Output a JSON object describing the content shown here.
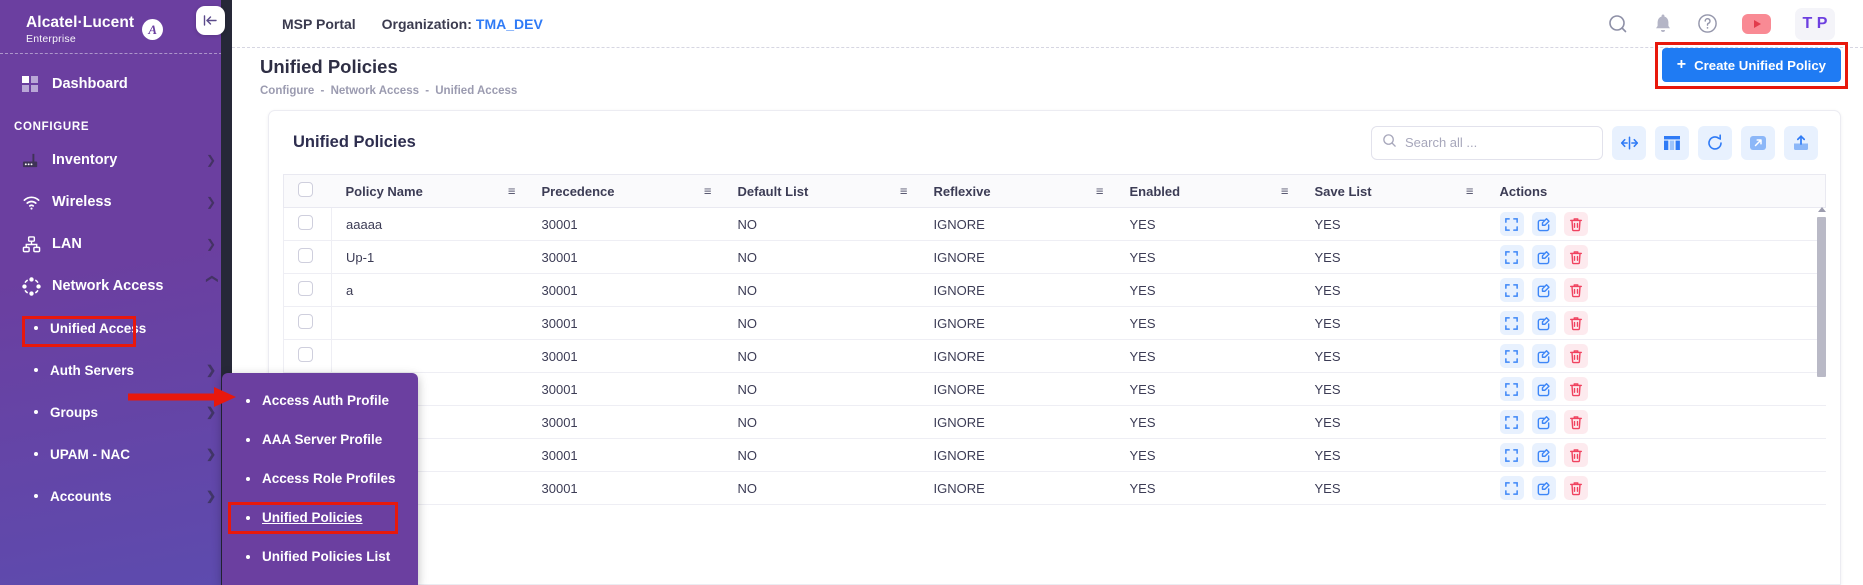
{
  "brand": {
    "name": "Alcatel·Lucent",
    "sub": "Enterprise",
    "logo_icon": "alcatel-lucent-logo-icon"
  },
  "topbar": {
    "collapse_icon": "collapse-sidebar-icon",
    "msp_portal": "MSP Portal",
    "organization_label": "Organization:",
    "organization_value": "TMA_DEV",
    "icons": {
      "search": "search-icon",
      "notifications": "bell-icon",
      "help": "help-circle-icon",
      "video": "youtube-play-icon"
    },
    "avatar_initials": "T P"
  },
  "page": {
    "title": "Unified Policies",
    "breadcrumb": [
      "Configure",
      "Network Access",
      "Unified Access"
    ],
    "breadcrumb_separator": "-",
    "create_button": "Create Unified Policy",
    "create_button_plus": "+",
    "create_button_color": "#1f7bf3",
    "highlight_color": "#e8180c"
  },
  "sidebar": {
    "dashboard": {
      "label": "Dashboard",
      "icon": "dashboard-grid-icon"
    },
    "section_label": "CONFIGURE",
    "items": [
      {
        "label": "Inventory",
        "icon": "router-icon",
        "chevron": "chevron-right-icon"
      },
      {
        "label": "Wireless",
        "icon": "wifi-icon",
        "chevron": "chevron-down-icon"
      },
      {
        "label": "LAN",
        "icon": "lan-topology-icon",
        "chevron": "chevron-down-icon"
      },
      {
        "label": "Network Access",
        "icon": "network-access-icon",
        "chevron": "chevron-up-icon"
      }
    ],
    "sub_items": [
      {
        "label": "Unified Access",
        "chevron": "",
        "highlighted": true
      },
      {
        "label": "Auth Servers",
        "chevron": "chevron-right-icon"
      },
      {
        "label": "Groups",
        "chevron": "chevron-right-icon"
      },
      {
        "label": "UPAM - NAC",
        "chevron": "chevron-right-icon"
      },
      {
        "label": "Accounts",
        "chevron": "chevron-right-icon"
      }
    ]
  },
  "flyout": {
    "items": [
      {
        "label": "Access Auth Profile"
      },
      {
        "label": "AAA Server Profile"
      },
      {
        "label": "Access Role Profiles"
      },
      {
        "label": "Unified Policies",
        "active": true
      },
      {
        "label": "Unified Policies List"
      }
    ],
    "arrow_icon": "red-arrow-pointer-icon"
  },
  "card": {
    "title": "Unified Policies",
    "search": {
      "placeholder": "Search all ...",
      "value": "",
      "icon": "search-icon"
    },
    "tools": [
      {
        "name": "fit-columns-icon",
        "glyph": "↔"
      },
      {
        "name": "column-settings-icon",
        "glyph": "▥"
      },
      {
        "name": "refresh-icon",
        "glyph": "⟳"
      },
      {
        "name": "expand-fullscreen-icon",
        "glyph": "↗"
      },
      {
        "name": "export-upload-icon",
        "glyph": "↑"
      }
    ]
  },
  "table": {
    "columns": [
      {
        "key": "select",
        "label": ""
      },
      {
        "key": "policy_name",
        "label": "Policy Name",
        "menu_icon": "column-menu-icon"
      },
      {
        "key": "precedence",
        "label": "Precedence",
        "menu_icon": "column-menu-icon"
      },
      {
        "key": "default_list",
        "label": "Default List",
        "menu_icon": "column-menu-icon"
      },
      {
        "key": "reflexive",
        "label": "Reflexive",
        "menu_icon": "column-menu-icon"
      },
      {
        "key": "enabled",
        "label": "Enabled",
        "menu_icon": "column-menu-icon"
      },
      {
        "key": "save_list",
        "label": "Save List",
        "menu_icon": "column-menu-icon"
      },
      {
        "key": "actions",
        "label": "Actions"
      }
    ],
    "action_icons": [
      {
        "name": "view-details-icon"
      },
      {
        "name": "edit-pencil-icon"
      },
      {
        "name": "delete-trash-icon"
      }
    ],
    "rows": [
      {
        "policy_name": "aaaaa",
        "precedence": "30001",
        "default_list": "NO",
        "reflexive": "IGNORE",
        "enabled": "YES",
        "save_list": "YES"
      },
      {
        "policy_name": "Up-1",
        "precedence": "30001",
        "default_list": "NO",
        "reflexive": "IGNORE",
        "enabled": "YES",
        "save_list": "YES"
      },
      {
        "policy_name": "a",
        "precedence": "30001",
        "default_list": "NO",
        "reflexive": "IGNORE",
        "enabled": "YES",
        "save_list": "YES"
      },
      {
        "policy_name": "",
        "precedence": "30001",
        "default_list": "NO",
        "reflexive": "IGNORE",
        "enabled": "YES",
        "save_list": "YES"
      },
      {
        "policy_name": "",
        "precedence": "30001",
        "default_list": "NO",
        "reflexive": "IGNORE",
        "enabled": "YES",
        "save_list": "YES"
      },
      {
        "policy_name": "",
        "precedence": "30001",
        "default_list": "NO",
        "reflexive": "IGNORE",
        "enabled": "YES",
        "save_list": "YES"
      },
      {
        "policy_name": "",
        "precedence": "30001",
        "default_list": "NO",
        "reflexive": "IGNORE",
        "enabled": "YES",
        "save_list": "YES"
      },
      {
        "policy_name": "",
        "precedence": "30001",
        "default_list": "NO",
        "reflexive": "IGNORE",
        "enabled": "YES",
        "save_list": "YES"
      },
      {
        "policy_name": "",
        "precedence": "30001",
        "default_list": "NO",
        "reflexive": "IGNORE",
        "enabled": "YES",
        "save_list": "YES"
      }
    ]
  }
}
